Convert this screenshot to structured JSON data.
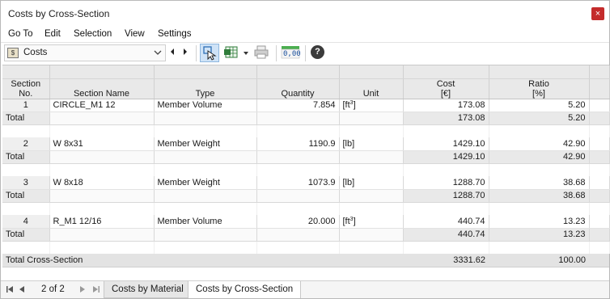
{
  "window": {
    "title": "Costs by Cross-Section",
    "close_glyph": "×"
  },
  "menu": [
    "Go To",
    "Edit",
    "Selection",
    "View",
    "Settings"
  ],
  "toolbar": {
    "combo_value": "Costs",
    "combo_icon_text": "$",
    "decimals_label": "0,00",
    "help_glyph": "?"
  },
  "table": {
    "headers": {
      "section_no": [
        "Section",
        "No."
      ],
      "section_name": "Section Name",
      "type": "Type",
      "quantity": "Quantity",
      "unit": "Unit",
      "cost": [
        "Cost",
        "[€]"
      ],
      "ratio": [
        "Ratio",
        "[%]"
      ]
    },
    "total_label": "Total",
    "groups": [
      {
        "no": "1",
        "name": "CIRCLE_M1 12",
        "type": "Member Volume",
        "quantity": "7.854",
        "unit": "[ft",
        "unit_sup": "3",
        "unit_close": "]",
        "cost": "173.08",
        "ratio": "5.20",
        "total_cost": "173.08",
        "total_ratio": "5.20"
      },
      {
        "no": "2",
        "name": "W 8x31",
        "type": "Member Weight",
        "quantity": "1190.9",
        "unit": "[lb]",
        "unit_sup": "",
        "unit_close": "",
        "cost": "1429.10",
        "ratio": "42.90",
        "total_cost": "1429.10",
        "total_ratio": "42.90"
      },
      {
        "no": "3",
        "name": "W 8x18",
        "type": "Member Weight",
        "quantity": "1073.9",
        "unit": "[lb]",
        "unit_sup": "",
        "unit_close": "",
        "cost": "1288.70",
        "ratio": "38.68",
        "total_cost": "1288.70",
        "total_ratio": "38.68"
      },
      {
        "no": "4",
        "name": "R_M1 12/16",
        "type": "Member Volume",
        "quantity": "20.000",
        "unit": "[ft",
        "unit_sup": "3",
        "unit_close": "]",
        "cost": "440.74",
        "ratio": "13.23",
        "total_cost": "440.74",
        "total_ratio": "13.23"
      }
    ],
    "grand_total": {
      "label": "Total Cross-Section",
      "cost": "3331.62",
      "ratio": "100.00"
    }
  },
  "pager": {
    "label": "2 of 2"
  },
  "tabs": [
    {
      "label": "Costs by Material",
      "active": false
    },
    {
      "label": "Costs by Cross-Section",
      "active": true
    }
  ]
}
